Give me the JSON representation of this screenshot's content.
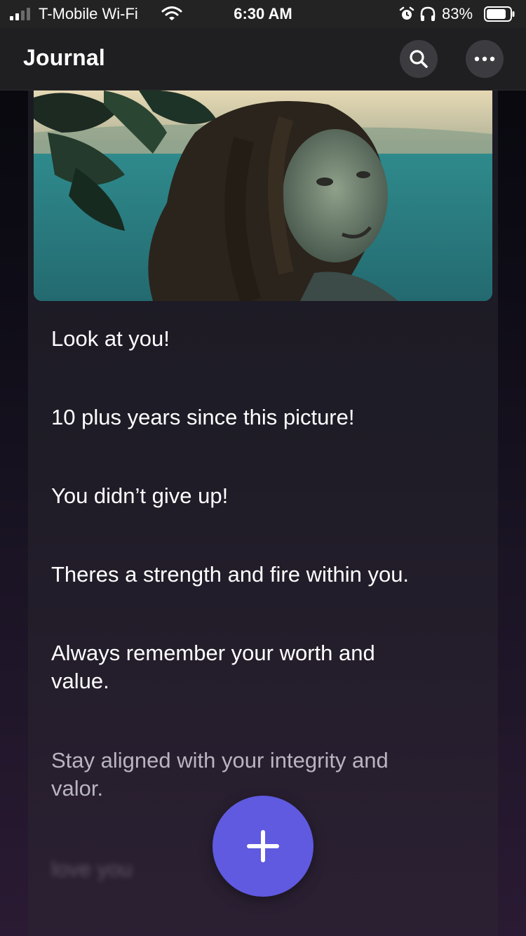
{
  "status_bar": {
    "carrier": "T-Mobile Wi-Fi",
    "time": "6:30 AM",
    "battery_percent": "83%",
    "battery_level": 0.83,
    "signal_bars_filled": 2,
    "signal_bars_total": 4,
    "icons": [
      "wifi-icon",
      "alarm-icon",
      "headphones-icon",
      "battery-icon"
    ]
  },
  "header": {
    "title": "Journal",
    "search_icon": "search-icon",
    "more_icon": "more-icon"
  },
  "entry": {
    "photo_icon": "entry-photo",
    "lines": [
      "Look at you!",
      "10 plus years since this picture!",
      "You didn’t give up!",
      "Theres a strength and fire within you.",
      "Always remember your worth and value.",
      "Stay aligned with your integrity and valor.",
      "love you"
    ]
  },
  "fab": {
    "icon": "plus-icon"
  },
  "colors": {
    "accent": "#5f5adf",
    "header_bg": "#1f1f21",
    "status_bg": "#232323"
  }
}
